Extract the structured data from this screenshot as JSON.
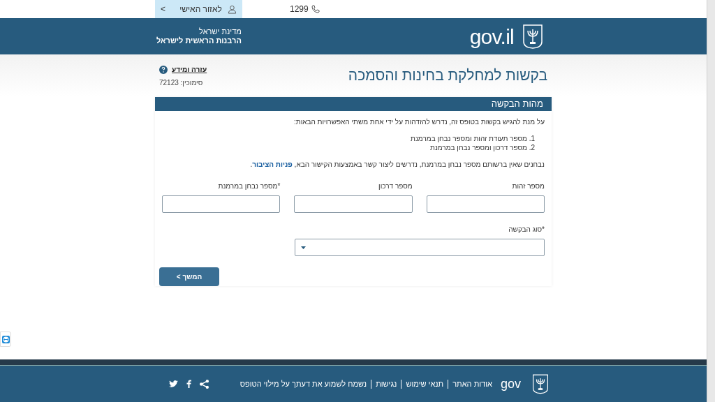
{
  "top_bar": {
    "personal_area": {
      "label": "לאזור האישי",
      "caret": ">"
    },
    "phone": "1299"
  },
  "header": {
    "logo_text": "gov.il",
    "org_lines": [
      "מדינת ישראל",
      "הרבנות הראשית לישראל"
    ]
  },
  "page": {
    "title": "בקשות למחלקת בחינות והסמכה",
    "help_link": "עזרה ומידע",
    "form_code": "סימוכין: 72123"
  },
  "section": {
    "title": "מהות הבקשה",
    "intro": "על מנת להגיש בקשות בטופס זה, נדרש להזדהות על ידי אחת משתי האפשרויות הבאות:",
    "options": [
      "1. מספר תעודת זהות ומספר נבחן במרמנת",
      "2. מספר דרכון ומספר נבחן במרמנת"
    ],
    "note": "נבחנים שאין ברשותם מספר נבחן במרמנת, נדרשים ליצור קשר באמצעות הקישור הבא, ",
    "note_link": "פניות הציבור",
    "note_end": ".",
    "fields": [
      {
        "label": "מספר זהות",
        "kind": "text"
      },
      {
        "label": "מספר דרכון",
        "kind": "text"
      },
      {
        "label": "*מספר נבחן במרמנת",
        "kind": "text"
      }
    ],
    "select": {
      "label": "*סוג הבקשה",
      "kind": "select"
    },
    "next_button": "המשך >"
  },
  "footer": {
    "logo_text": "gov",
    "links": [
      "אודות האתר",
      "תנאי שימוש",
      "נגישות",
      "נשמח לשמוע את דעתך על מילוי הטופס"
    ]
  }
}
